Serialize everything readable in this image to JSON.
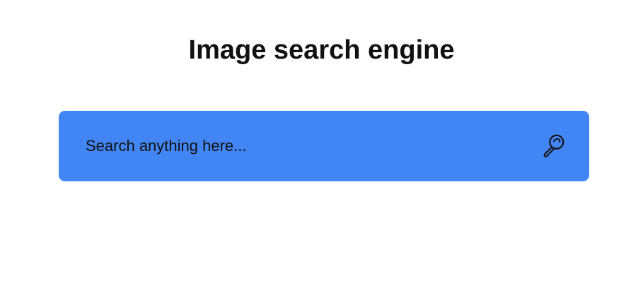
{
  "header": {
    "title": "Image search engine"
  },
  "search": {
    "placeholder": "Search anything here...",
    "value": "",
    "button_icon": "search-icon",
    "bar_color": "#4285f4"
  }
}
